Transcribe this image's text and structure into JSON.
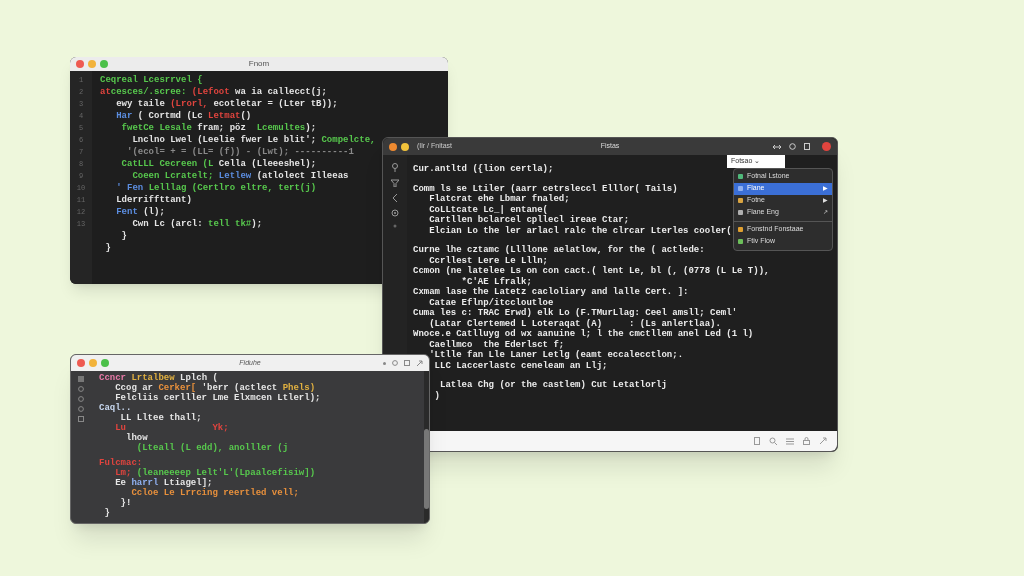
{
  "windows": [
    {
      "title": "Fnom",
      "gutter": [
        "1",
        "2",
        "3",
        "4",
        "5",
        "6",
        "7",
        "8",
        "9",
        "10",
        "11",
        "12",
        "13"
      ],
      "lines": [
        [
          {
            "text": "Ceqreal Lcesrrvel {",
            "color": "#57c84d"
          }
        ],
        [
          {
            "text": "at",
            "color": "#e0443e"
          },
          {
            "text": "cesces/.scree: ",
            "color": "#57c84d"
          },
          {
            "text": "(Lefoot",
            "color": "#e0443e"
          },
          {
            "text": " wa ia callecct(j;",
            "color": "#e6e6e6"
          }
        ],
        [
          {
            "text": "   ewy taile ",
            "color": "#e6e6e6"
          },
          {
            "text": "(Lrorl,",
            "color": "#e0443e"
          },
          {
            "text": " ecotletar = (Lter tB));",
            "color": "#e6e6e6"
          }
        ],
        [
          {
            "text": "   Har",
            "color": "#5b8de0"
          },
          {
            "text": " ( Cortmd (Lc ",
            "color": "#e6e6e6"
          },
          {
            "text": "Letmat",
            "color": "#e0443e"
          },
          {
            "text": "()",
            "color": "#e6e6e6"
          }
        ],
        [
          {
            "text": "    fwetCe Lesale ",
            "color": "#57c84d"
          },
          {
            "text": "fram; pöz  ",
            "color": "#e6e6e6"
          },
          {
            "text": "Lcemultes",
            "color": "#57c84d"
          },
          {
            "text": ");",
            "color": "#e6e6e6"
          }
        ],
        [
          {
            "text": "      Lnclno Lwel (Leelie fwer Le blit'; ",
            "color": "#e6e6e6"
          },
          {
            "text": "Compelcte,",
            "color": "#57c84d"
          }
        ],
        [
          {
            "text": "     '(ecol= + = (LL= (f)) - (Lwt); ----------1",
            "color": "#8a8a8a"
          }
        ],
        [
          {
            "text": "    CatLLL Cecreen (L",
            "color": "#57c84d"
          },
          {
            "text": " Cella (Lleeeshel);",
            "color": "#e6e6e6"
          }
        ],
        [
          {
            "text": "      Coeen Lcratelt; ",
            "color": "#57c84d"
          },
          {
            "text": "Letlew",
            "color": "#5b8de0"
          },
          {
            "text": " (atlolect Illeeas",
            "color": "#e6e6e6"
          }
        ],
        [
          {
            "text": "   ' Fen",
            "color": "#5b8de0"
          },
          {
            "text": " Lelllag (Certlro eltre, tert(j)",
            "color": "#57c84d"
          }
        ],
        [
          {
            "text": "   Lderriffttant)",
            "color": "#e6e6e6"
          }
        ],
        [
          {
            "text": "   Fent",
            "color": "#5b8de0"
          },
          {
            "text": " (l);",
            "color": "#e6e6e6"
          }
        ],
        [
          {
            "text": "      Cwn Lc (arcl: ",
            "color": "#e6e6e6"
          },
          {
            "text": "tell tk#",
            "color": "#57c84d"
          },
          {
            "text": ");",
            "color": "#e6e6e6"
          }
        ],
        [
          {
            "text": "    }",
            "color": "#e6e6e6"
          }
        ],
        [
          {
            "text": " }",
            "color": "#e6e6e6"
          }
        ]
      ]
    },
    {
      "title": "Fistas",
      "breadcrumb": "(Ilr / Fnitast",
      "blocks": [
        [
          "Cur.antltd ({lion certla);"
        ],
        [
          "Comm ls se Ltiler (aarr cetrsleccl Elllor( Tails)",
          "   Flatcrat ehe Lbmar fnaled;",
          "   CoLLtcate Lc_| entane(",
          "   Cartllen bclarcel cpllecl ireae Ctar;",
          "   Elcian Lo the ler arlacl ralc the clrcar Lterles cooler("
        ],
        [
          "Curne lhe cztamc (Llllone aelatlow, for the ( actlede:",
          "   Ccrllest Lere Le Llln;",
          "Ccmon (ne latelee Ls on con cact.( lent Le, bl (, (0778 (L Le T)),",
          "         *C'AE Lfralk;",
          "Cxmam lase the Latetz cacloliary and lalle Cert. ]:",
          "   Catae Eflnp/itccloutloe",
          "Cuma les c: TRAC Erwd) elk Lo (F.TMurLlag: Ceel amsll; Ceml'",
          "   (Latar Clertemed L Loteraqat (A)     : (Ls anlertlaa).",
          "Wnoce.e Catlluyg od wx aanuine l; l the cmctllem anel Led (1 l)",
          "   Caellmco  the Ederlsct f;",
          "   'Ltlle fan Lle Laner Letlg (eamt eccalecctlon;.",
          "    LLC Laccerlastc ceneleam an Llj;"
        ],
        [
          "     Latlea Chg (or the castlem) Cut Letatlorlj",
          "    )"
        ]
      ],
      "menu": {
        "header": "Fotsao ⌄",
        "items": [
          {
            "label": "Fotnal Lstone",
            "color": "#4fb87a",
            "selected": false
          },
          {
            "label": "Flane",
            "color": "#8fb0f0",
            "selected": true,
            "mark": "▶"
          },
          {
            "label": "Fotne",
            "color": "#d9a441",
            "selected": false,
            "mark": "▶"
          },
          {
            "label": "Flane Eng",
            "color": "#b0b0b0",
            "selected": false,
            "mark": "↗"
          },
          {
            "label": "Fonstnd Fonstaae",
            "color": "#e0a030",
            "selected": false
          },
          {
            "label": "Ftiv Flow",
            "color": "#6cbf5a",
            "selected": false
          }
        ]
      }
    },
    {
      "title": "Fiduhe",
      "lines": [
        [
          {
            "text": "Ccncr ",
            "color": "#e87aa8"
          },
          {
            "text": "Lrtalbew",
            "color": "#e0b040"
          },
          {
            "text": " Lplch (",
            "color": "#e6e6e6"
          }
        ],
        [
          {
            "text": "   Ccog ar ",
            "color": "#e6e6e6"
          },
          {
            "text": "Cerker[",
            "color": "#e8903c"
          },
          {
            "text": " 'berr (actlect ",
            "color": "#e6e6e6"
          },
          {
            "text": "Phels)",
            "color": "#e0b040"
          }
        ],
        [
          {
            "text": "   Felcliis cerlller Lme Elxmcen Ltlerl);",
            "color": "#e6e6e6"
          }
        ],
        [
          {
            "text": "Caql..",
            "color": "#c8d8f0"
          }
        ],
        [
          {
            "text": "    LL Lltee thall;",
            "color": "#e6e6e6"
          }
        ],
        [
          {
            "text": "   Lu                Yk;",
            "color": "#e0443e"
          }
        ],
        [
          {
            "text": "     lhow",
            "color": "#e6e6e6"
          }
        ],
        [
          {
            "text": "       (Lteall (L edd), anolller (j",
            "color": "#57c84d"
          }
        ],
        [
          {
            "text": "Fulcmac:",
            "color": "#e0443e"
          }
        ],
        [
          {
            "text": "   Lm; ",
            "color": "#e0443e"
          },
          {
            "text": "(leaneeeep Lelt'L'(Lpaalcefisiw])",
            "color": "#57c84d"
          }
        ],
        [
          {
            "text": "   Ee ",
            "color": "#e6e6e6"
          },
          {
            "text": "harrl",
            "color": "#8fb0f0"
          },
          {
            "text": " Ltiagel];",
            "color": "#e6e6e6"
          }
        ],
        [
          {
            "text": "      Ccloe Le Lrrcing reertled vell;",
            "color": "#e8903c"
          }
        ],
        [
          {
            "text": "    }!",
            "color": "#e6e6e6"
          }
        ],
        [
          {
            "text": " }",
            "color": "#e6e6e6"
          }
        ]
      ]
    }
  ]
}
